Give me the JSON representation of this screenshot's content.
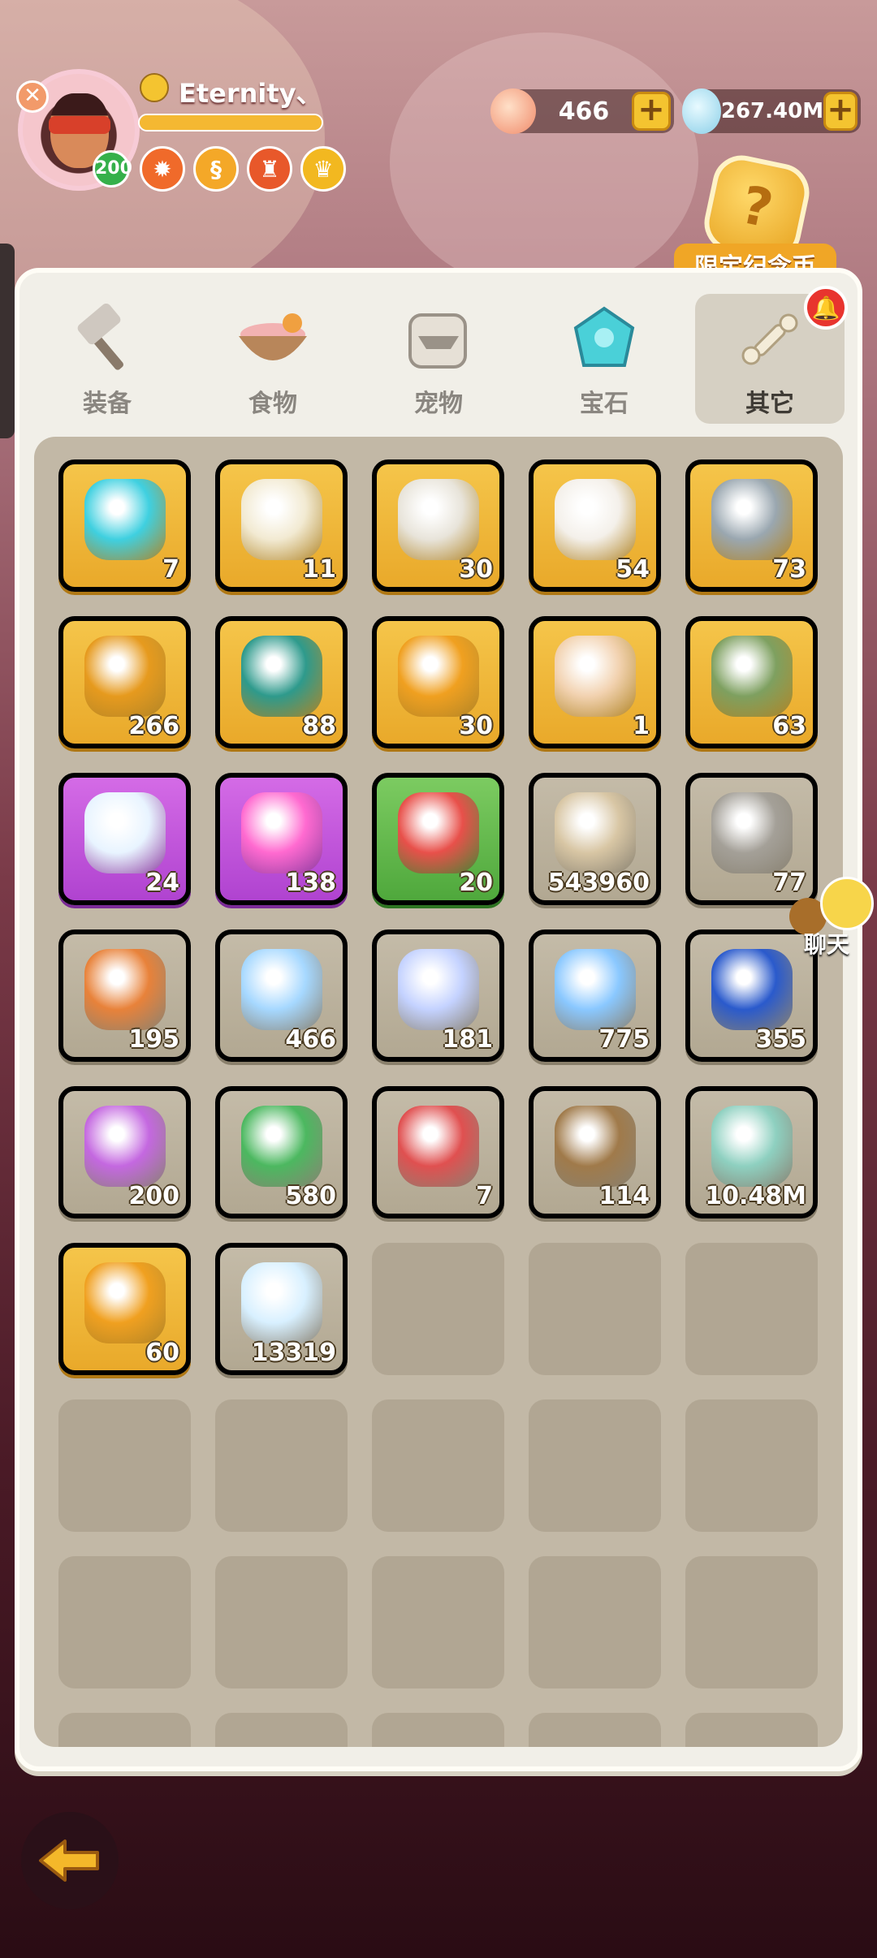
{
  "player": {
    "name": "Eternity、",
    "level": "200",
    "exp_fraction": 1.0,
    "badges": [
      "fire-badge",
      "swirl-badge",
      "shield-badge",
      "crown-badge"
    ]
  },
  "currencies": [
    {
      "icon": "shell-icon",
      "value": "466"
    },
    {
      "icon": "gem-icon",
      "value": "267.40M"
    }
  ],
  "limited_coin": {
    "label": "限定纪念币"
  },
  "tabs": [
    {
      "label": "装备",
      "icon": "hammer-icon",
      "active": false
    },
    {
      "label": "食物",
      "icon": "food-bowl-icon",
      "active": false
    },
    {
      "label": "宠物",
      "icon": "pet-skull-icon",
      "active": false
    },
    {
      "label": "宝石",
      "icon": "gemstone-icon",
      "active": false
    },
    {
      "label": "其它",
      "icon": "bone-icon",
      "active": true
    }
  ],
  "items": [
    {
      "icon": "cyan-stone-icon",
      "count": "7",
      "rarity": "gold",
      "color": "#3fd0e0"
    },
    {
      "icon": "scroll-horn-icon",
      "count": "11",
      "rarity": "gold",
      "color": "#f2ead2"
    },
    {
      "icon": "pickaxe-icon",
      "count": "30",
      "rarity": "gold",
      "color": "#e8e4da"
    },
    {
      "icon": "dice-icon",
      "count": "54",
      "rarity": "gold",
      "color": "#f4f0ea"
    },
    {
      "icon": "magnifier-icon",
      "count": "73",
      "rarity": "gold",
      "color": "#9aa7b0"
    },
    {
      "icon": "gold-coin-cake-icon",
      "count": "266",
      "rarity": "gold",
      "color": "#e69a1e"
    },
    {
      "icon": "carrot-bag-icon",
      "count": "88",
      "rarity": "gold",
      "color": "#2e9a8c"
    },
    {
      "icon": "spiral-coin-icon",
      "count": "30",
      "rarity": "gold",
      "color": "#f0a020"
    },
    {
      "icon": "character-card-icon",
      "count": "1",
      "rarity": "gold",
      "color": "#f2d2b0"
    },
    {
      "icon": "stone-golem-icon",
      "count": "63",
      "rarity": "gold",
      "color": "#7ea060"
    },
    {
      "icon": "rainbow-crystal-icon",
      "count": "24",
      "rarity": "purple",
      "color": "#e8f4ff"
    },
    {
      "icon": "pink-crystal-icon",
      "count": "138",
      "rarity": "purple",
      "color": "#ff6ad0"
    },
    {
      "icon": "dino-pet-icon",
      "count": "20",
      "rarity": "green",
      "color": "#e8504a"
    },
    {
      "icon": "medal-icon",
      "count": "543960",
      "rarity": "white",
      "color": "#d8c6a4"
    },
    {
      "icon": "stone-tablet-icon",
      "count": "77",
      "rarity": "white",
      "color": "#a4a098"
    },
    {
      "icon": "meal-plate-icon",
      "count": "195",
      "rarity": "white",
      "color": "#e8823a"
    },
    {
      "icon": "moon-icon",
      "count": "466",
      "rarity": "white",
      "color": "#a6d8ff"
    },
    {
      "icon": "star-icon",
      "count": "181",
      "rarity": "white",
      "color": "#c4d2ff"
    },
    {
      "icon": "prism-icon",
      "count": "775",
      "rarity": "white",
      "color": "#8ac8ff"
    },
    {
      "icon": "blue-rune-crystal-icon",
      "count": "355",
      "rarity": "white",
      "color": "#2a5acc"
    },
    {
      "icon": "purple-ticket-icon",
      "count": "200",
      "rarity": "white",
      "color": "#c468e0"
    },
    {
      "icon": "green-ticket-icon",
      "count": "580",
      "rarity": "white",
      "color": "#4cb860"
    },
    {
      "icon": "red-ticket-icon",
      "count": "7",
      "rarity": "white",
      "color": "#e05050"
    },
    {
      "icon": "brown-ticket-icon",
      "count": "114",
      "rarity": "white",
      "color": "#a07a4a"
    },
    {
      "icon": "rune-stone-icon",
      "count": "10.48M",
      "rarity": "white",
      "color": "#8ed0c0"
    },
    {
      "icon": "rune-coin-icon",
      "count": "60",
      "rarity": "gold",
      "color": "#f0a020"
    },
    {
      "icon": "holo-card-icon",
      "count": "13319",
      "rarity": "white",
      "color": "#d8f0ff"
    }
  ],
  "empty_cells": 23,
  "chat": {
    "label": "聊天"
  },
  "back_button": {
    "icon": "back-arrow-icon"
  }
}
